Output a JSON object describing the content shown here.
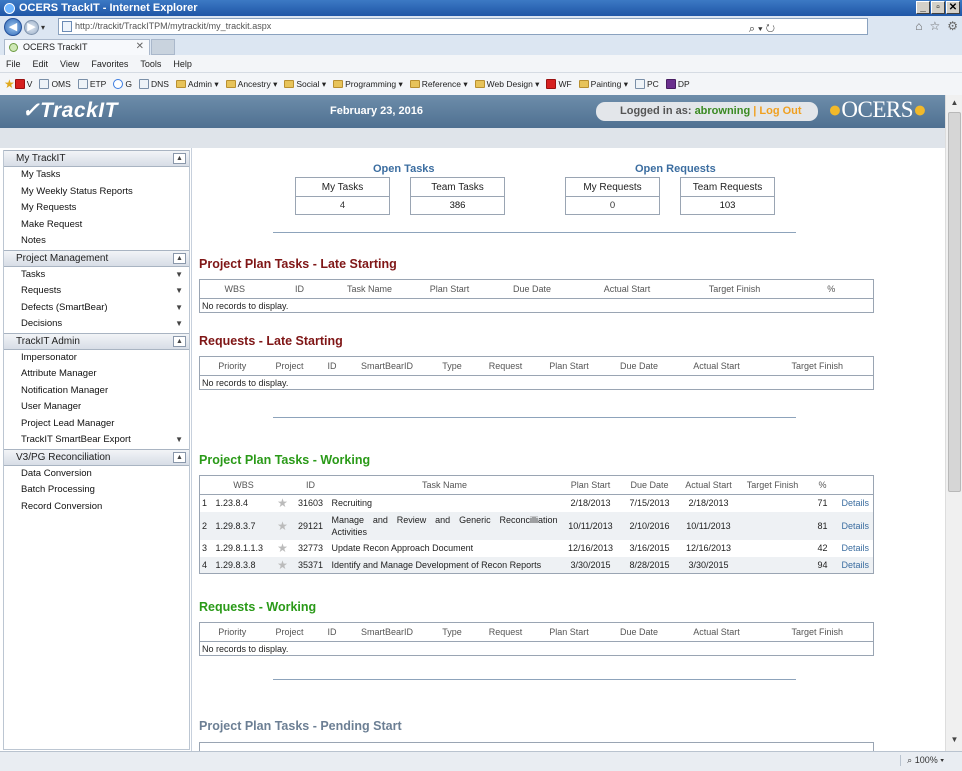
{
  "browser": {
    "title": "OCERS TrackIT - Internet Explorer",
    "url": "http://trackit/TrackITPM/mytrackit/my_trackit.aspx",
    "tab_label": "OCERS TrackIT",
    "menu": [
      "File",
      "Edit",
      "View",
      "Favorites",
      "Tools",
      "Help"
    ],
    "favorites": [
      {
        "label": "V",
        "icon": "v-icon"
      },
      {
        "label": "OMS",
        "icon": "page-icon"
      },
      {
        "label": "ETP",
        "icon": "page-icon"
      },
      {
        "label": "G",
        "icon": "google-icon"
      },
      {
        "label": "DNS",
        "icon": "dns-icon"
      },
      {
        "label": "Admin ▾",
        "icon": "folder-icon"
      },
      {
        "label": "Ancestry ▾",
        "icon": "folder-icon"
      },
      {
        "label": "Social ▾",
        "icon": "folder-icon"
      },
      {
        "label": "Programming ▾",
        "icon": "folder-icon"
      },
      {
        "label": "Reference ▾",
        "icon": "folder-icon"
      },
      {
        "label": "Web Design ▾",
        "icon": "folder-icon"
      },
      {
        "label": "WF",
        "icon": "wf-icon"
      },
      {
        "label": "Painting ▾",
        "icon": "folder-icon"
      },
      {
        "label": "PC",
        "icon": "pc-icon"
      },
      {
        "label": "DP",
        "icon": "dp-icon"
      }
    ],
    "zoom": "100%"
  },
  "header": {
    "logo": "TrackIT",
    "date": "February 23, 2016",
    "logged_in_label": "Logged in as:",
    "username": "abrowning",
    "separator": "|",
    "logout": "Log Out",
    "brand": "OCERS"
  },
  "sidebar": {
    "sections": [
      {
        "title": "My TrackIT",
        "items": [
          {
            "label": "My Tasks"
          },
          {
            "label": "My Weekly Status Reports"
          },
          {
            "label": "My Requests"
          },
          {
            "label": "Make Request"
          },
          {
            "label": "Notes"
          }
        ]
      },
      {
        "title": "Project Management",
        "items": [
          {
            "label": "Tasks",
            "chevron": true
          },
          {
            "label": "Requests",
            "chevron": true
          },
          {
            "label": "Defects (SmartBear)",
            "chevron": true
          },
          {
            "label": "Decisions",
            "chevron": true
          }
        ]
      },
      {
        "title": "TrackIT Admin",
        "items": [
          {
            "label": "Impersonator"
          },
          {
            "label": "Attribute Manager"
          },
          {
            "label": "Notification Manager"
          },
          {
            "label": "User Manager"
          },
          {
            "label": "Project Lead Manager"
          },
          {
            "label": "TrackIT SmartBear Export",
            "chevron": true
          }
        ]
      },
      {
        "title": "V3/PG Reconciliation",
        "items": [
          {
            "label": "Data Conversion"
          },
          {
            "label": "Batch Processing"
          },
          {
            "label": "Record Conversion"
          }
        ]
      }
    ]
  },
  "summary": {
    "open_tasks": {
      "title": "Open Tasks",
      "my_label": "My Tasks",
      "my_value": "4",
      "team_label": "Team Tasks",
      "team_value": "386"
    },
    "open_requests": {
      "title": "Open Requests",
      "my_label": "My Requests",
      "my_value": "0",
      "team_label": "Team Requests",
      "team_value": "103"
    }
  },
  "sections": {
    "pp_late": {
      "title": "Project Plan Tasks - Late Starting",
      "columns": [
        "WBS",
        "ID",
        "Task Name",
        "Plan Start",
        "Due Date",
        "Actual Start",
        "Target Finish",
        "%"
      ],
      "empty": "No records to display."
    },
    "req_late": {
      "title": "Requests - Late Starting",
      "columns": [
        "Priority",
        "Project",
        "ID",
        "SmartBearID",
        "Type",
        "Request",
        "Plan Start",
        "Due Date",
        "Actual Start",
        "Target Finish"
      ],
      "empty": "No records to display."
    },
    "pp_working": {
      "title": "Project Plan Tasks - Working",
      "columns": [
        "",
        "WBS",
        "",
        "ID",
        "Task Name",
        "Plan Start",
        "Due Date",
        "Actual Start",
        "Target Finish",
        "%",
        ""
      ],
      "rows": [
        {
          "n": "1",
          "wbs": "1.23.8.4",
          "id": "31603",
          "name": "Recruiting",
          "plan": "2/18/2013",
          "due": "7/15/2013",
          "actual": "2/18/2013",
          "target": "",
          "pct": "71",
          "link": "Details"
        },
        {
          "n": "2",
          "wbs": "1.29.8.3.7",
          "id": "29121",
          "name": "Manage and Review and Generic Reconcilliation Activities",
          "plan": "10/11/2013",
          "due": "2/10/2016",
          "actual": "10/11/2013",
          "target": "",
          "pct": "81",
          "link": "Details"
        },
        {
          "n": "3",
          "wbs": "1.29.8.1.1.3",
          "id": "32773",
          "name": "Update Recon Approach Document",
          "plan": "12/16/2013",
          "due": "3/16/2015",
          "actual": "12/16/2013",
          "target": "",
          "pct": "42",
          "link": "Details"
        },
        {
          "n": "4",
          "wbs": "1.29.8.3.8",
          "id": "35371",
          "name": "Identify and Manage Development of Recon Reports",
          "plan": "3/30/2015",
          "due": "8/28/2015",
          "actual": "3/30/2015",
          "target": "",
          "pct": "94",
          "link": "Details"
        }
      ]
    },
    "req_working": {
      "title": "Requests - Working",
      "columns": [
        "Priority",
        "Project",
        "ID",
        "SmartBearID",
        "Type",
        "Request",
        "Plan Start",
        "Due Date",
        "Actual Start",
        "Target Finish"
      ],
      "empty": "No records to display."
    },
    "pp_pending": {
      "title": "Project Plan Tasks - Pending Start"
    }
  },
  "colors": {
    "header_bg": "#4f7091",
    "late_title": "#7f1616",
    "working_title": "#2a9a18",
    "pending_title": "#6c7f94",
    "link": "#3b6da0"
  }
}
